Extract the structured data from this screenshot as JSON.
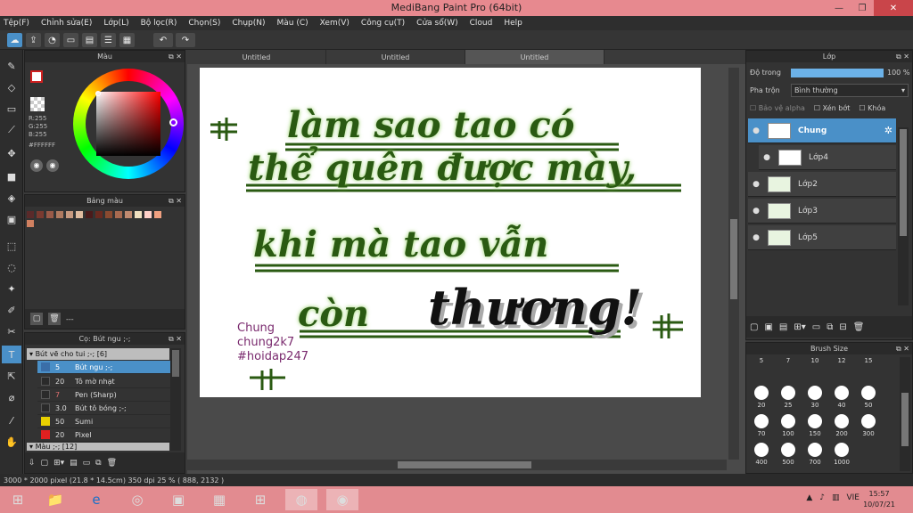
{
  "window": {
    "title": "MediBang Paint Pro (64bit)",
    "controls": [
      "—",
      "❐",
      "✕"
    ]
  },
  "menu": [
    "Tệp(F)",
    "Chỉnh sửa(E)",
    "Lớp(L)",
    "Bộ lọc(R)",
    "Chọn(S)",
    "Chụp(N)",
    "Màu (C)",
    "Xem(V)",
    "Công cụ(T)",
    "Cửa sổ(W)",
    "Cloud",
    "Help"
  ],
  "toolbar": {
    "icons": [
      "cloud-icon",
      "export-icon",
      "chat-icon",
      "comment-icon",
      "document-icon",
      "list-icon",
      "grid-icon"
    ],
    "undo_icon": "undo-icon",
    "redo_icon": "redo-icon"
  },
  "color_panel": {
    "title": "Màu",
    "rgb": [
      "R:255",
      "G:255",
      "B:255"
    ],
    "hex": "#FFFFFF",
    "hue_color": "#ff0000"
  },
  "palette_panel": {
    "title": "Bảng màu",
    "swatches": [
      "#5a2a2a",
      "#7a3a30",
      "#9a5a48",
      "#b07a60",
      "#c89a80",
      "#e0bca0",
      "#4a1a1a",
      "#6a2a20",
      "#8a4a30",
      "#a86a50",
      "#c08a70",
      "#f0e0c0",
      "#ffd0c8",
      "#f0a080",
      "#d08060"
    ],
    "count_label": "---"
  },
  "brush_panel": {
    "title": "Cọ: Bút ngu ;-;",
    "group_label": "Bút vẽ cho tui ;-; [6]",
    "brushes": [
      {
        "size": "5",
        "name": "Bút ngu ;-;",
        "color": "#3a6ea8",
        "selected": true
      },
      {
        "size": "20",
        "name": "Tô mờ nhạt",
        "color": "#2a2a2a",
        "selected": false
      },
      {
        "size": "7",
        "name": "Pen (Sharp)",
        "color": "#2a2a2a",
        "selected": false
      },
      {
        "size": "3.0",
        "name": "Bút tô bóng ;-;",
        "color": "#2a2a2a",
        "selected": false
      },
      {
        "size": "50",
        "name": "Sumi",
        "color": "#e8d000",
        "selected": false
      },
      {
        "size": "20",
        "name": "Pixel",
        "color": "#e02020",
        "selected": false
      }
    ],
    "group2_label": "Màu ;-; [12]"
  },
  "tabs": [
    {
      "label": "Untitled",
      "active": false
    },
    {
      "label": "Untitled",
      "active": false
    },
    {
      "label": "Untitled",
      "active": true
    }
  ],
  "canvas": {
    "lines": [
      "làm sao tao có",
      "thể quên được mày,",
      "khi mà tao vẫn",
      "còn"
    ],
    "highlight": "thương!",
    "signature": [
      "Chung",
      "chung2k7",
      "#hoidap247"
    ]
  },
  "layers_panel": {
    "title": "Lớp",
    "opacity_label": "Độ trong",
    "opacity_value": "100 %",
    "opacity_fraction": 1.0,
    "blend_label": "Pha trộn",
    "blend_value": "Bình thường",
    "protect_alpha": "Bảo vệ alpha",
    "clip": "Xén bớt",
    "lock": "Khóa",
    "layers": [
      {
        "name": "Chung",
        "selected": true,
        "folder": true
      },
      {
        "name": "Lớp4",
        "selected": false,
        "folder": false
      },
      {
        "name": "Lớp2",
        "selected": false,
        "folder": false
      },
      {
        "name": "Lớp3",
        "selected": false,
        "folder": false
      },
      {
        "name": "Lớp5",
        "selected": false,
        "folder": false
      }
    ]
  },
  "brush_size_panel": {
    "title": "Brush Size",
    "sizes": [
      "5",
      "7",
      "10",
      "12",
      "15",
      "20",
      "25",
      "30",
      "40",
      "50",
      "70",
      "100",
      "150",
      "200",
      "300",
      "400",
      "500",
      "700",
      "1000"
    ]
  },
  "status": {
    "text": "3000 * 2000 pixel   (21.8 * 14.5cm)   350 dpi   25 %   ( 888, 2132 )"
  },
  "taskbar": {
    "items": [
      "folder-icon",
      "ie-icon",
      "chrome-icon",
      "powerpoint-icon",
      "app-icon",
      "paint-icon",
      "medibang-icon"
    ],
    "lang": "VIE",
    "time": "15:57",
    "date": "10/07/21"
  },
  "colors": {
    "green_ink": "#2a5a12",
    "green_glow": "#8fcf5c",
    "purple_ink": "#7a2a6e",
    "accent": "#4a90c8"
  }
}
